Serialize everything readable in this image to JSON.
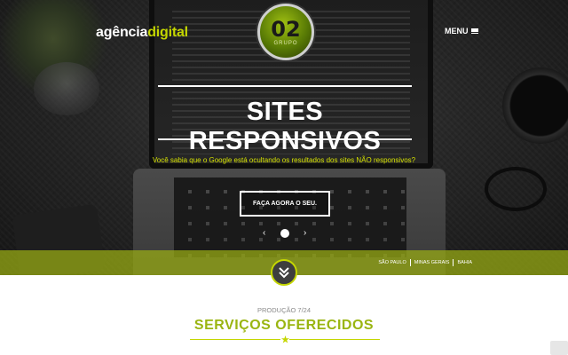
{
  "header": {
    "brand_part1": "agência",
    "brand_part2": "digital",
    "logo_number": "02",
    "logo_group": "GRUPO",
    "menu_label": "MENU",
    "menu_icon": "hamburger-icon"
  },
  "hero": {
    "title": "SITES RESPONSIVOS",
    "subtitle": "Você sabia que o Google está ocultando os resultados dos sites NÃO responsivos?",
    "cta_label": "FAÇA AGORA O SEU.",
    "prev_icon": "chevron-left-icon",
    "next_icon": "chevron-right-icon",
    "slides_total": 1,
    "slide_active": 1
  },
  "band": {
    "locations": [
      "SÃO PAULO",
      "MINAS GERAIS",
      "BAHIA"
    ],
    "scroll_icon": "double-chevron-down-icon"
  },
  "section": {
    "kicker": "PRODUÇÃO 7/24",
    "title": "SERVIÇOS OFERECIDOS",
    "divider_icon": "star-icon"
  },
  "colors": {
    "accent": "#c4d600",
    "accent_dark": "#9ab511",
    "hero_bg": "#262626",
    "band": "#9baf14",
    "text_light": "#ffffff",
    "kicker": "#8a8a8a"
  }
}
